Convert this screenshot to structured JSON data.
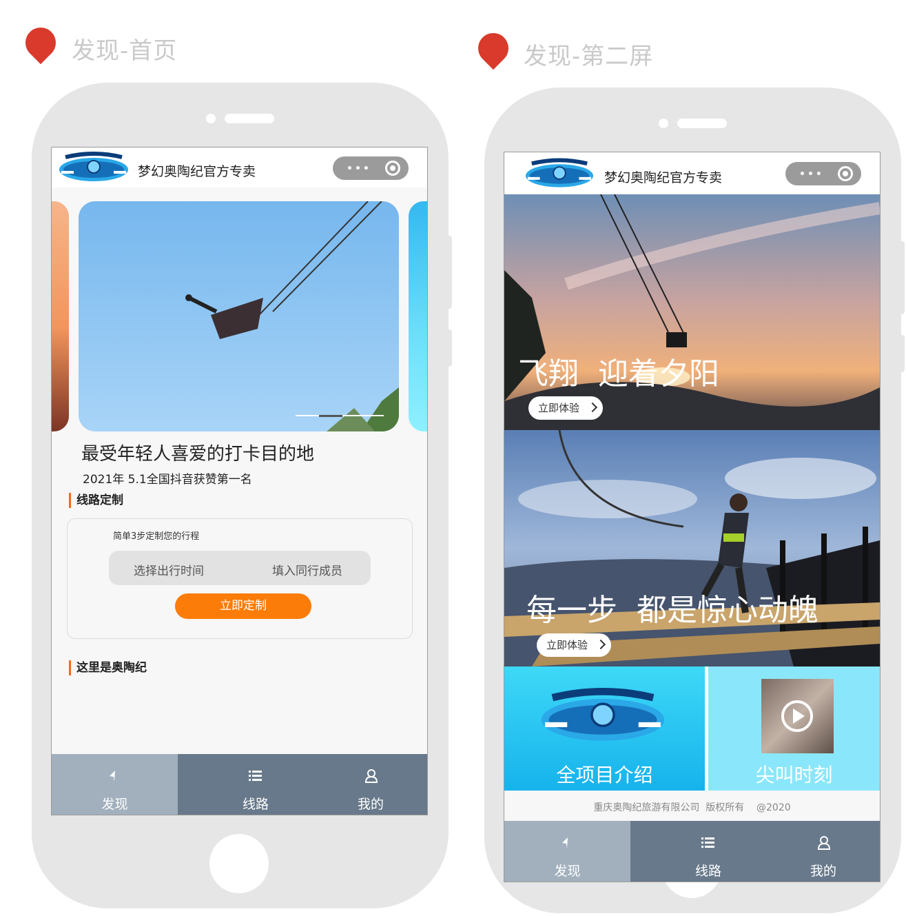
{
  "captions": {
    "left": "发现-首页",
    "right": "发现-第二屏"
  },
  "app": {
    "title": "梦幻奥陶纪官方专卖",
    "capsule_dots": "•••"
  },
  "home": {
    "banner": {
      "title": "最受年轻人喜爱的打卡目的地",
      "subtitle": "2021年 5.1全国抖音获赞第一名"
    },
    "route_section": {
      "title": "线路定制",
      "hint": "简单3步定制您的行程",
      "option_time": "选择出行时间",
      "option_members": "填入同行成员",
      "button": "立即定制"
    },
    "intro_section": {
      "title": "这里是奥陶纪"
    }
  },
  "second": {
    "card1": {
      "headline": "飞翔  迎着夕阳",
      "button": "立即体验"
    },
    "card2": {
      "headline": "每一步  都是惊心动魄",
      "button": "立即体验"
    },
    "tile_left": {
      "label": "全项目介绍"
    },
    "tile_right": {
      "label": "尖叫时刻"
    },
    "footer": "重庆奥陶纪旅游有限公司  版权所有    @2020"
  },
  "tabbar": {
    "items": [
      {
        "label": "发现",
        "icon": "navigation-arrow-icon"
      },
      {
        "label": "线路",
        "icon": "list-icon"
      },
      {
        "label": "我的",
        "icon": "user-icon"
      }
    ]
  },
  "colors": {
    "accent_orange": "#fb7c08",
    "tab_active": "#a2b0be",
    "tab_bg": "#68798b",
    "pin_red": "#d93a2b"
  }
}
